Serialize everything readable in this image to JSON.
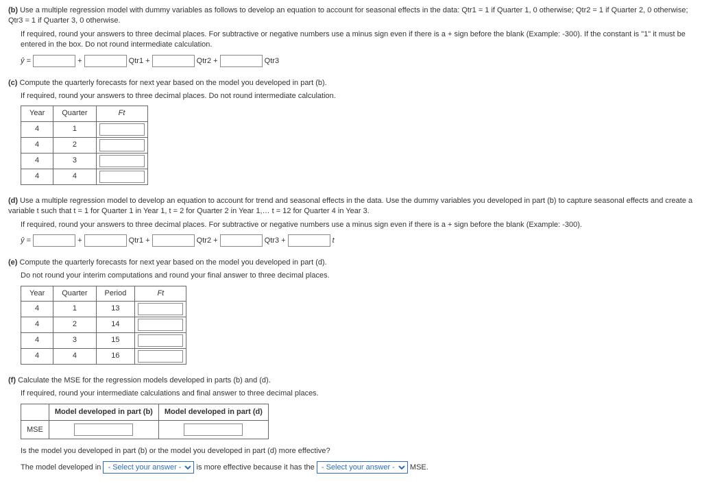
{
  "b": {
    "label": "(b)",
    "text1": "Use a multiple regression model with dummy variables as follows to develop an equation to account for seasonal effects in the data: Qtr1 = 1 if Quarter 1, 0 otherwise; Qtr2 = 1 if Quarter 2, 0 otherwise; Qtr3 = 1 if Quarter 3, 0 otherwise.",
    "text2": "If required, round your answers to three decimal places. For subtractive or negative numbers use a minus sign even if there is a + sign before the blank (Example: -300). If the constant is \"1\" it must be entered in the box. Do not round intermediate calculation.",
    "yhat": "ŷ =",
    "plus": "+",
    "q1": "Qtr1 +",
    "q2": "Qtr2 +",
    "q3": "Qtr3"
  },
  "c": {
    "label": "(c)",
    "text1": "Compute the quarterly forecasts for next year based on the model you developed in part (b).",
    "text2": "If required, round your answers to three decimal places. Do not round intermediate calculation.",
    "col_year": "Year",
    "col_quarter": "Quarter",
    "col_ft": "Ft",
    "rows": [
      {
        "year": "4",
        "quarter": "1"
      },
      {
        "year": "4",
        "quarter": "2"
      },
      {
        "year": "4",
        "quarter": "3"
      },
      {
        "year": "4",
        "quarter": "4"
      }
    ]
  },
  "d": {
    "label": "(d)",
    "text1": "Use a multiple regression model to develop an equation to account for trend and seasonal effects in the data. Use the dummy variables you developed in part (b) to capture seasonal effects and create a variable t such that t = 1 for Quarter 1 in Year 1, t = 2 for Quarter 2 in Year 1,… t = 12 for Quarter 4 in Year 3.",
    "text2": "If required, round your answers to three decimal places. For subtractive or negative numbers use a minus sign even if there is a + sign before the blank (Example: -300).",
    "yhat": "ŷ =",
    "plus": "+",
    "q1": "Qtr1 +",
    "q2": "Qtr2 +",
    "q3": "Qtr3 +",
    "t": "t"
  },
  "e": {
    "label": "(e)",
    "text1": "Compute the quarterly forecasts for next year based on the model you developed in part (d).",
    "text2": "Do not round your interim computations and round your final answer to three decimal places.",
    "col_year": "Year",
    "col_quarter": "Quarter",
    "col_period": "Period",
    "col_ft": "Ft",
    "rows": [
      {
        "year": "4",
        "quarter": "1",
        "period": "13"
      },
      {
        "year": "4",
        "quarter": "2",
        "period": "14"
      },
      {
        "year": "4",
        "quarter": "3",
        "period": "15"
      },
      {
        "year": "4",
        "quarter": "4",
        "period": "16"
      }
    ]
  },
  "f": {
    "label": "(f)",
    "text1": "Calculate the MSE for the regression models developed in parts (b) and (d).",
    "text2": "If required, round your intermediate calculations and final answer to three decimal places.",
    "col_b": "Model developed in part (b)",
    "col_d": "Model developed in part (d)",
    "row_mse": "MSE",
    "q1": "Is the model you developed in part (b) or the model you developed in part (d) more effective?",
    "q2a": "The model developed in",
    "q2b": "is more effective because it has the",
    "q2c": "MSE.",
    "select_placeholder": "- Select your answer -"
  }
}
